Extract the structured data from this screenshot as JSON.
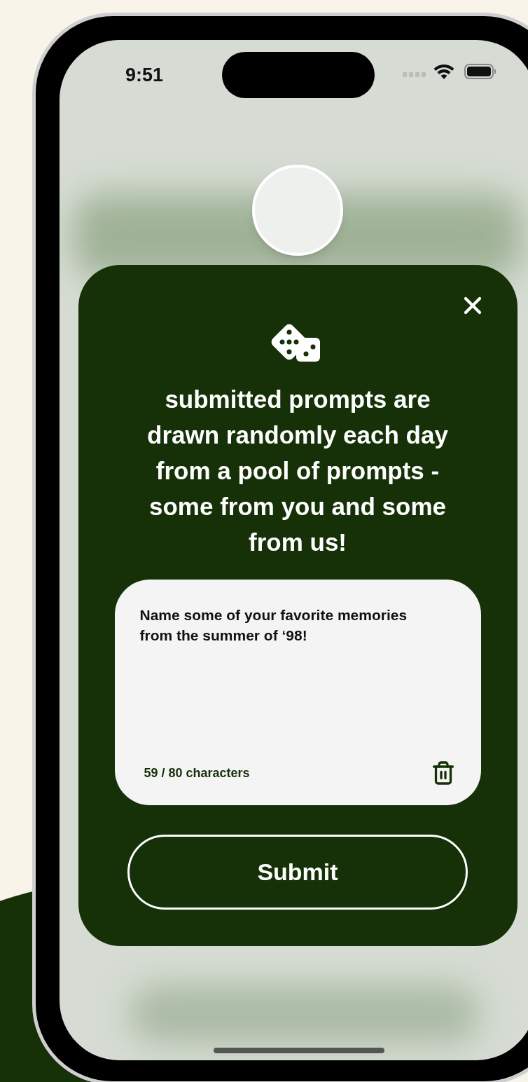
{
  "status_bar": {
    "time": "9:51"
  },
  "modal": {
    "heading": "submitted prompts are drawn randomly each day from a pool of prompts - some from you and some from us!",
    "prompt": {
      "value": "Name some of your favorite memories from the summer of ‘98!",
      "counter": "59 / 80 characters"
    },
    "submit_button": "Submit"
  }
}
